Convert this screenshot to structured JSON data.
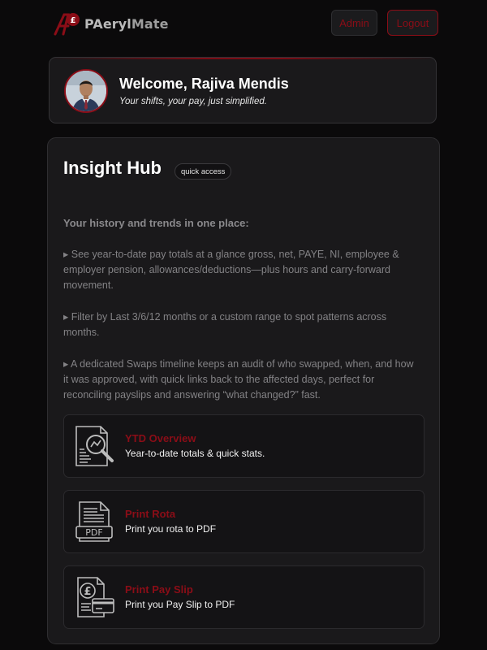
{
  "header": {
    "logo_prefix": "PAeryl",
    "logo_suffix": "Mate",
    "admin_label": "Admin",
    "logout_label": "Logout",
    "accent_color": "#8b0d17"
  },
  "welcome": {
    "title": "Welcome, Rajiva Mendis",
    "subtitle": "Your shifts, your pay, just simplified."
  },
  "insight": {
    "title": "Insight Hub",
    "badge": "quick access",
    "lead": "Your history and trends in one place:",
    "paragraphs": [
      "▸  See year-to-date pay totals at a glance gross, net, PAYE, NI, employee & employer pension, allowances/deductions—plus hours and carry-forward movement.",
      "▸  Filter by Last 3/6/12 months or a custom range to spot patterns across months.",
      "▸  A dedicated Swaps timeline keeps an audit of who swapped, when, and how it was approved, with quick links back to the affected days, perfect for reconciling payslips and answering “what changed?” fast."
    ],
    "tiles": [
      {
        "title": "YTD Overview",
        "desc": "Year-to-date totals & quick stats.",
        "icon": "report-magnifier-icon"
      },
      {
        "title": "Print Rota",
        "desc": "Print you rota to PDF",
        "icon": "pdf-document-icon"
      },
      {
        "title": "Print Pay Slip",
        "desc": "Print you Pay Slip to PDF",
        "icon": "payslip-pound-card-icon"
      }
    ]
  }
}
